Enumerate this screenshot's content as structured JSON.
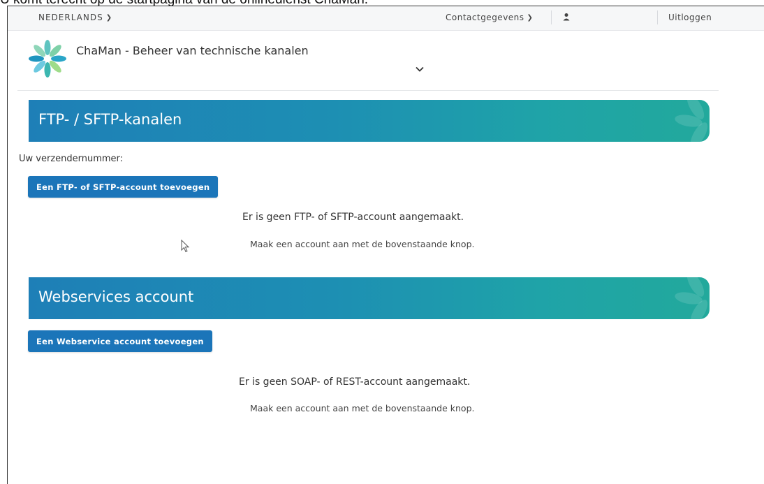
{
  "caption": "U komt terecht op de startpagina van de onlinedienst ChaMan.",
  "topbar": {
    "language": "NEDERLANDS",
    "contact": "Contactgegevens",
    "logout": "Uitloggen"
  },
  "header": {
    "title": "ChaMan - Beheer van technische kanalen"
  },
  "ftp_section": {
    "title": "FTP- / SFTP-kanalen",
    "sender_label": "Uw verzendernummer:",
    "add_button": "Een FTP- of SFTP-account toevoegen",
    "empty_title": "Er is geen FTP- of SFTP-account aangemaakt.",
    "empty_hint": "Maak een account aan met de bovenstaande knop."
  },
  "ws_section": {
    "title": "Webservices account",
    "add_button": "Een Webservice account toevoegen",
    "empty_title": "Er is geen SOAP- of REST-account aangemaakt.",
    "empty_hint": "Maak een account aan met de bovenstaande knop."
  },
  "colors": {
    "banner_start": "#1e7fb7",
    "banner_end": "#22a99c",
    "button": "#1b75b9"
  },
  "icons": [
    "chaman-logo-icon",
    "chevron-down-icon",
    "user-icon",
    "leaf-decoration-icon",
    "mouse-cursor-icon"
  ]
}
